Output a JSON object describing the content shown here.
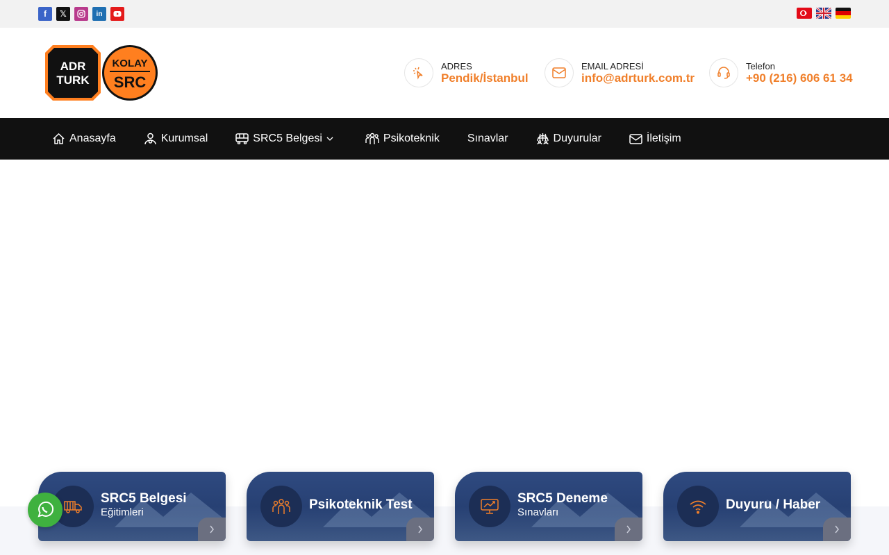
{
  "social": [
    "facebook-icon",
    "x-icon",
    "instagram-icon",
    "linkedin-icon",
    "youtube-icon"
  ],
  "flags": [
    "turkish-flag",
    "english-flag",
    "german-flag"
  ],
  "logo": {
    "left_top": "ADR",
    "left_bottom": "TURK",
    "right_top": "KOLAY",
    "right_bottom": "SRC"
  },
  "contact": {
    "address_label": "ADRES",
    "address_value": "Pendik/İstanbul",
    "email_label": "EMAIL ADRESİ",
    "email_value": "info@adrturk.com.tr",
    "phone_label": "Telefon",
    "phone_value": "+90 (216) 606 61 34"
  },
  "nav": {
    "home": "Anasayfa",
    "corporate": "Kurumsal",
    "src5": "SRC5 Belgesi",
    "psycho": "Psikoteknik",
    "exams": "Sınavlar",
    "announcements": "Duyurular",
    "contact": "İletişim"
  },
  "cards": [
    {
      "title": "SRC5 Belgesi",
      "subtitle": "Eğitimleri"
    },
    {
      "title": "Psikoteknik Test",
      "subtitle": ""
    },
    {
      "title": "SRC5 Deneme",
      "subtitle": "Sınavları"
    },
    {
      "title": "Duyuru / Haber",
      "subtitle": ""
    }
  ],
  "colors": {
    "accent": "#f07f2a",
    "nav_bg": "#111111",
    "card_bg": "#2a4377",
    "whatsapp": "#3fb13f"
  }
}
